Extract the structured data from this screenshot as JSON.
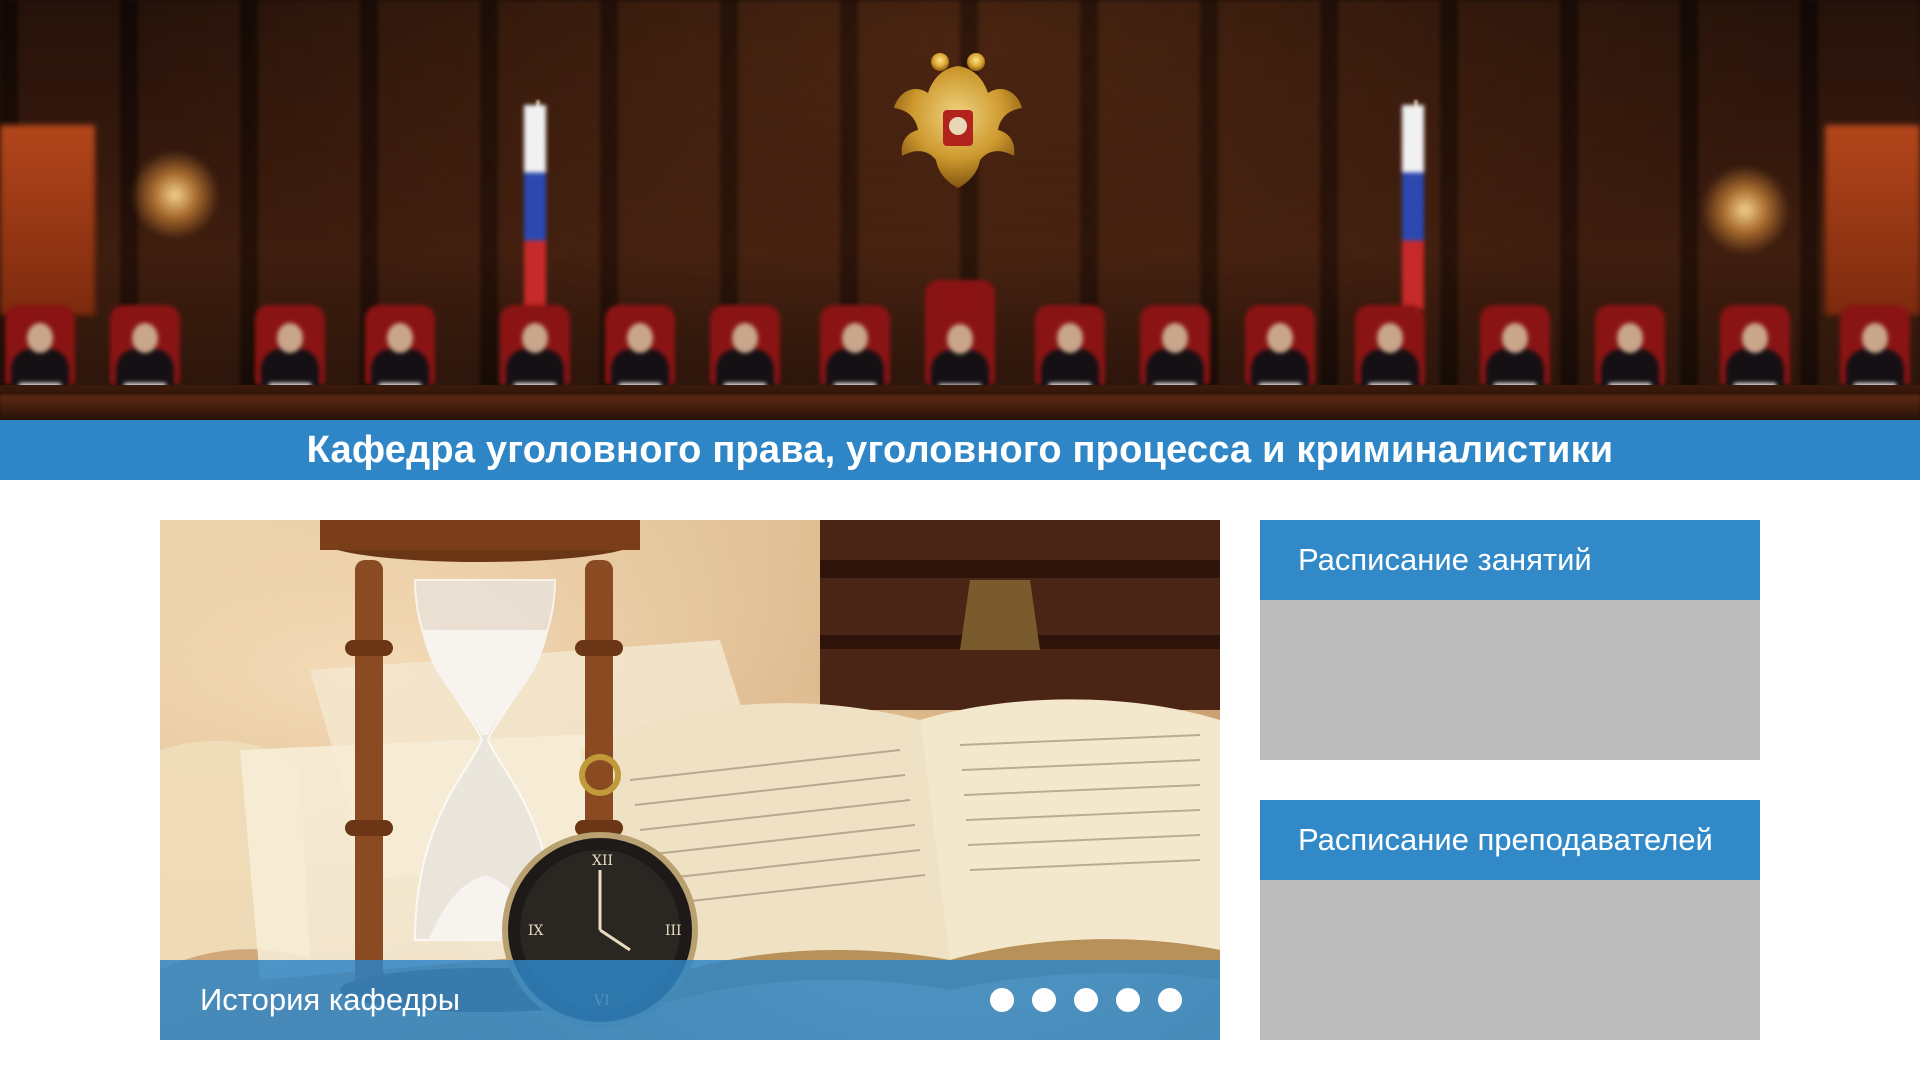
{
  "header": {
    "title": "Кафедра уголовного права, уголовного процесса и криминалистики"
  },
  "slider": {
    "caption": "История кафедры",
    "slide_count": 5,
    "active_slide": 1
  },
  "cards": [
    {
      "title": "Расписание занятий"
    },
    {
      "title": "Расписание преподавателей"
    }
  ],
  "colors": {
    "accent": "#2f86c6",
    "card_body": "#bcbcbc",
    "background": "#ffffff"
  },
  "icons": {
    "hero": "courtroom-photo",
    "slide": "hourglass-book-photo",
    "emblem": "coat-of-arms-icon"
  }
}
